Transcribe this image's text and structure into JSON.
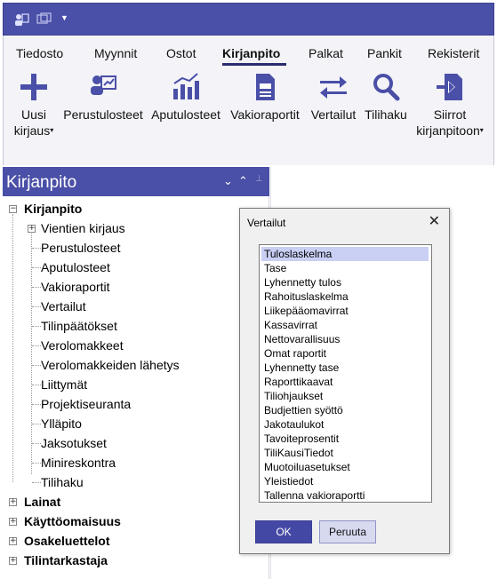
{
  "ribbon": {
    "tabs": [
      {
        "label": "Tiedosto",
        "active": false
      },
      {
        "label": "Myynnit",
        "active": false
      },
      {
        "label": "Ostot",
        "active": false
      },
      {
        "label": "Kirjanpito",
        "active": true
      },
      {
        "label": "Palkat",
        "active": false
      },
      {
        "label": "Pankit",
        "active": false
      },
      {
        "label": "Rekisterit",
        "active": false
      }
    ],
    "buttons": [
      {
        "line1": "Uusi",
        "line2": "kirjaus",
        "icon": "plus-icon"
      },
      {
        "line1": "Perustulosteet",
        "line2": "",
        "icon": "report-chart-icon"
      },
      {
        "line1": "Aputulosteet",
        "line2": "",
        "icon": "bar-chart-icon"
      },
      {
        "line1": "Vakioraportit",
        "line2": "",
        "icon": "document-icon"
      },
      {
        "line1": "Vertailut",
        "line2": "",
        "icon": "compare-arrows-icon"
      },
      {
        "line1": "Tilihaku",
        "line2": "",
        "icon": "search-icon"
      },
      {
        "line1": "Siirrot",
        "line2": "kirjanpitoon",
        "icon": "transfer-icon"
      }
    ],
    "accent": "#4a4fa7"
  },
  "panel": {
    "title": "Kirjanpito",
    "tree": {
      "root": "Kirjanpito",
      "children": [
        "Vientien kirjaus",
        "Perustulosteet",
        "Aputulosteet",
        "Vakioraportit",
        "Vertailut",
        "Tilinpäätökset",
        "Verolomakkeet",
        "Verolomakkeiden lähetys",
        "Liittymät",
        "Projektiseuranta",
        "Ylläpito",
        "Jaksotukset",
        "Minireskontra",
        "Tilihaku"
      ],
      "siblings": [
        "Lainat",
        "Käyttöomaisuus",
        "Osakeluettelot",
        "Tilintarkastaja"
      ]
    }
  },
  "dialog": {
    "title": "Vertailut",
    "items": [
      "Tuloslaskelma",
      "Tase",
      "Lyhennetty tulos",
      "Rahoituslaskelma",
      "Liikepääomavirrat",
      "Kassavirrat",
      "Nettovarallisuus",
      "Omat raportit",
      "Lyhennetty tase",
      "Raporttikaavat",
      "Tiliohjaukset",
      "Budjettien syöttö",
      "Jakotaulukot",
      "Tavoiteprosentit",
      "TiliKausiTiedot",
      "Muotoiluasetukset",
      "Yleistiedot",
      "Tallenna vakioraportti"
    ],
    "selected": "Tuloslaskelma",
    "ok_label": "OK",
    "cancel_label": "Peruuta"
  }
}
